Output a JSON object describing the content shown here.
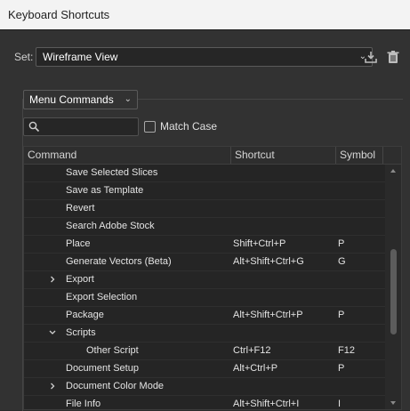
{
  "window": {
    "title": "Keyboard Shortcuts"
  },
  "set": {
    "label": "Set:",
    "value": "Wireframe View"
  },
  "toolbar": {
    "save_icon": "save-download-icon",
    "delete_icon": "trash-icon"
  },
  "category": {
    "value": "Menu Commands"
  },
  "search": {
    "placeholder": "",
    "value": ""
  },
  "match_case": {
    "label": "Match Case",
    "checked": false
  },
  "table": {
    "columns": {
      "command": "Command",
      "shortcut": "Shortcut",
      "symbol": "Symbol"
    },
    "rows": [
      {
        "indent": 1,
        "expander": "",
        "command": "Save Selected Slices",
        "shortcut": "",
        "symbol": ""
      },
      {
        "indent": 1,
        "expander": "",
        "command": "Save as Template",
        "shortcut": "",
        "symbol": ""
      },
      {
        "indent": 1,
        "expander": "",
        "command": "Revert",
        "shortcut": "",
        "symbol": ""
      },
      {
        "indent": 1,
        "expander": "",
        "command": "Search Adobe Stock",
        "shortcut": "",
        "symbol": ""
      },
      {
        "indent": 1,
        "expander": "",
        "command": "Place",
        "shortcut": "Shift+Ctrl+P",
        "symbol": "P"
      },
      {
        "indent": 1,
        "expander": "",
        "command": "Generate Vectors (Beta)",
        "shortcut": "Alt+Shift+Ctrl+G",
        "symbol": "G"
      },
      {
        "indent": 1,
        "expander": "collapsed",
        "command": "Export",
        "shortcut": "",
        "symbol": ""
      },
      {
        "indent": 1,
        "expander": "",
        "command": "Export Selection",
        "shortcut": "",
        "symbol": ""
      },
      {
        "indent": 1,
        "expander": "",
        "command": "Package",
        "shortcut": "Alt+Shift+Ctrl+P",
        "symbol": "P"
      },
      {
        "indent": 1,
        "expander": "expanded",
        "command": "Scripts",
        "shortcut": "",
        "symbol": ""
      },
      {
        "indent": 2,
        "expander": "",
        "command": "Other Script",
        "shortcut": "Ctrl+F12",
        "symbol": "F12"
      },
      {
        "indent": 1,
        "expander": "",
        "command": "Document Setup",
        "shortcut": "Alt+Ctrl+P",
        "symbol": "P"
      },
      {
        "indent": 1,
        "expander": "collapsed",
        "command": "Document Color Mode",
        "shortcut": "",
        "symbol": ""
      },
      {
        "indent": 1,
        "expander": "",
        "command": "File Info",
        "shortcut": "Alt+Shift+Ctrl+I",
        "symbol": "I"
      }
    ]
  }
}
